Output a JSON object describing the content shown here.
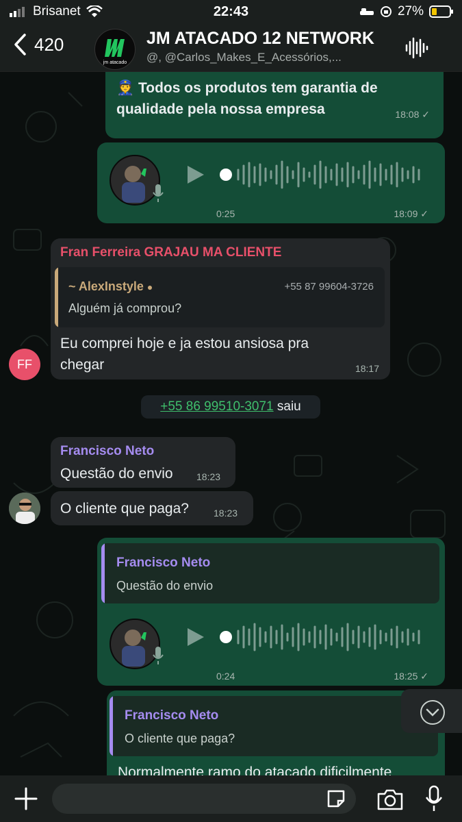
{
  "status": {
    "carrier": "Brisanet",
    "time": "22:43",
    "battery": "27%"
  },
  "header": {
    "back_count": "420",
    "title": "JM ATACADO 12 NETWORK",
    "subtitle": "@, @Carlos_Makes_E_Acessórios,...",
    "logo_text": "jm atacado"
  },
  "messages": {
    "m1_text": "👮 Todos os produtos tem garantia de qualidade pela nossa empresa",
    "m1_time": "18:08 ✓",
    "m2_duration": "0:25",
    "m2_time": "18:09 ✓",
    "m3_sender": "Fran Ferreira GRAJAU MA CLIENTE",
    "m3_quote_name": "~ AlexInstyle ",
    "m3_quote_phone": "+55 87 99604-3726",
    "m3_quote_text": "Alguém já comprou?",
    "m3_text": "Eu comprei hoje e ja estou ansiosa pra chegar",
    "m3_time": "18:17",
    "m3_avatar": "FF",
    "sys_phone": "+55 86 99510-3071",
    "sys_action": " saiu",
    "m4_sender": "Francisco Neto",
    "m4_text": "Questão do envio",
    "m4_time": "18:23",
    "m5_text": "O cliente que paga?",
    "m5_time": "18:23",
    "m6_quote_name": "Francisco Neto",
    "m6_quote_text": "Questão do envio",
    "m6_duration": "0:24",
    "m6_time": "18:25 ✓",
    "m7_quote_name": "Francisco Neto",
    "m7_quote_text": "O cliente que paga?",
    "m7_text": "Normalmente ramo do atacado dificilmente"
  },
  "colors": {
    "out_bubble": "#144d37",
    "in_bubble": "#232628",
    "accent": "#3fbf6c",
    "name_red": "#e8506a",
    "name_purple": "#a58cf0"
  },
  "icons": [
    "back-chevron-icon",
    "audio-wave-icon",
    "play-icon",
    "mic-icon",
    "check-icon",
    "plus-icon",
    "sticker-icon",
    "camera-icon",
    "microphone-icon",
    "chevron-down-icon"
  ]
}
